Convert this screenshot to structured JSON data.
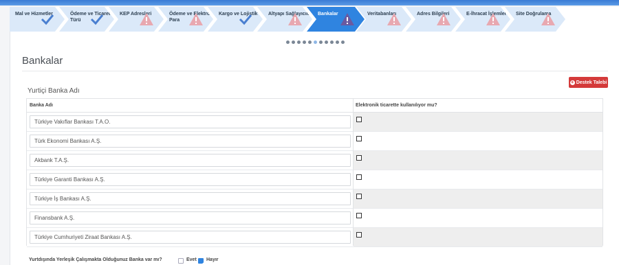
{
  "steps": [
    {
      "label": "Mal ve Hizmetler",
      "status": "done",
      "icon": "check-icon"
    },
    {
      "label": "Ödeme ve Ticaret Türü",
      "status": "done",
      "icon": "check-icon"
    },
    {
      "label": "KEP Adresleri",
      "status": "warning",
      "icon": "warning-icon"
    },
    {
      "label": "Ödeme ve Elektronik Para",
      "status": "warning",
      "icon": "warning-icon"
    },
    {
      "label": "Kargo ve Lojistik",
      "status": "done",
      "icon": "check-icon"
    },
    {
      "label": "Altyapı Sağlayıcıları",
      "status": "warning",
      "icon": "warning-icon"
    },
    {
      "label": "Bankalar",
      "status": "active",
      "icon": "warning-icon"
    },
    {
      "label": "Veritabanları",
      "status": "warning",
      "icon": "warning-icon"
    },
    {
      "label": "Adres Bilgileri",
      "status": "warning",
      "icon": "warning-icon"
    },
    {
      "label": "E-İhracat İşlemleri",
      "status": "warning",
      "icon": "warning-icon"
    },
    {
      "label": "Site Doğrulama",
      "status": "warning",
      "icon": "warning-icon"
    }
  ],
  "pagination": {
    "count": 11,
    "current": 6
  },
  "page": {
    "title": "Bankalar",
    "support_button": "Destek Talebi",
    "section_title": "Yurtiçi Banka Adı"
  },
  "table": {
    "headers": [
      "Banka Adı",
      "Elektronik ticarette kullanılıyor mu?"
    ],
    "rows": [
      {
        "bank": "Türkiye Vakıflar Bankası T.A.O.",
        "used": false
      },
      {
        "bank": "Türk Ekonomi Bankası A.Ş.",
        "used": false
      },
      {
        "bank": "Akbank T.A.Ş.",
        "used": false
      },
      {
        "bank": "Türkiye Garanti Bankası A.Ş.",
        "used": false
      },
      {
        "bank": "Türkiye İş Bankası A.Ş.",
        "used": false
      },
      {
        "bank": "Finansbank A.Ş.",
        "used": false
      },
      {
        "bank": "Türkiye Cumhuriyeti Ziraat Bankası A.Ş.",
        "used": false
      }
    ]
  },
  "foreign_question": {
    "label": "Yurtdışında Yerleşik Çalışmakta Olduğunuz Banka var mı?",
    "options": [
      {
        "label": "Evet",
        "checked": false
      },
      {
        "label": "Hayır",
        "checked": true
      }
    ]
  },
  "colors": {
    "step_bg": "#dbe9f9",
    "step_active": "#2f84e0",
    "check": "#4a7fd0",
    "warning": "#e8a8b0",
    "support_btn": "#d43a3a"
  }
}
